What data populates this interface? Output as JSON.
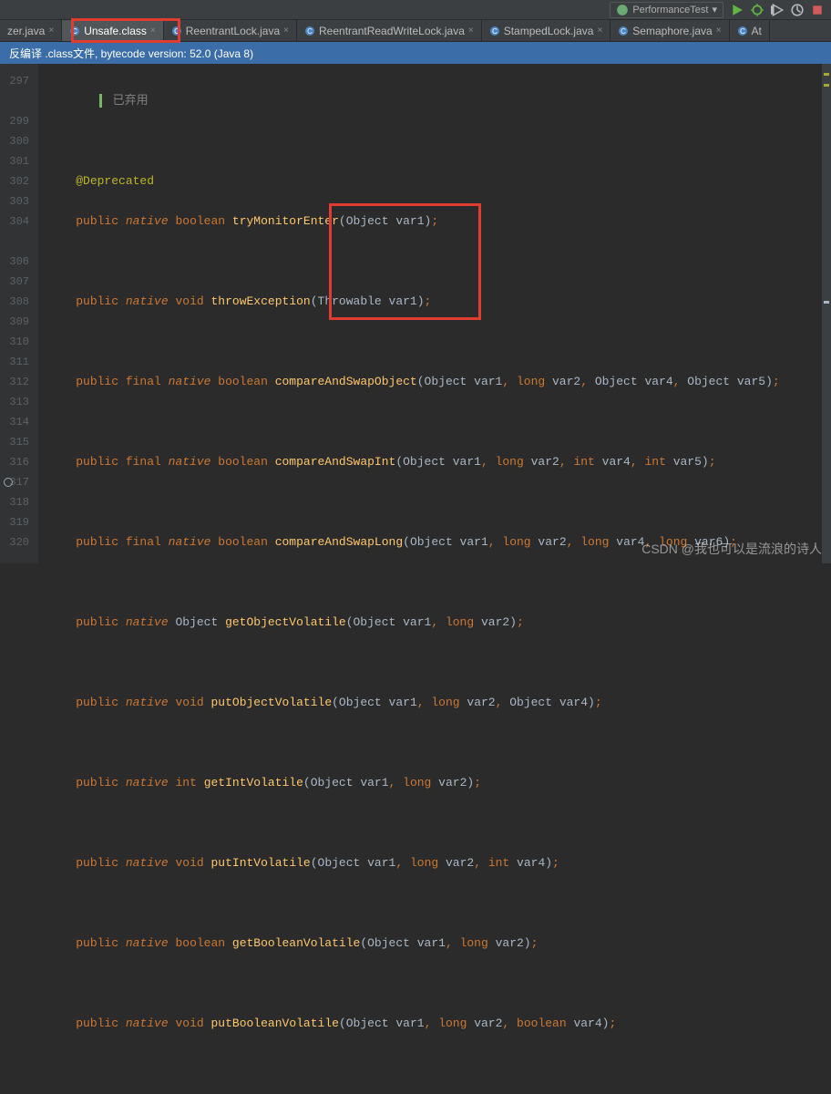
{
  "toolbar": {
    "config_label": "PerformanceTest",
    "run_icon": "run-icon",
    "debug_icon": "debug-icon"
  },
  "tabs": [
    {
      "label": "zer.java"
    },
    {
      "label": "Unsafe.class",
      "active": true
    },
    {
      "label": "ReentrantLock.java"
    },
    {
      "label": "ReentrantReadWriteLock.java"
    },
    {
      "label": "StampedLock.java"
    },
    {
      "label": "Semaphore.java"
    },
    {
      "label": "At"
    }
  ],
  "info_bar": {
    "text": "反编译 .class文件, bytecode version: 52.0 (Java 8)"
  },
  "gutter": {
    "lines": [
      "297",
      "",
      "299",
      "300",
      "301",
      "302",
      "303",
      "304",
      "",
      "306",
      "307",
      "308",
      "309",
      "310",
      "311",
      "312",
      "313",
      "314",
      "315",
      "316",
      "317",
      "318",
      "319",
      "320"
    ],
    "breakpoints": [
      317
    ]
  },
  "code": {
    "deprecated_tag_label": "已弃用",
    "ann_deprecated": "@Deprecated",
    "l300": {
      "mods": "public native boolean",
      "fn": "tryMonitorEnter",
      "sig": "(Object var1);"
    },
    "l302": {
      "mods": "public native void",
      "fn": "throwException",
      "sig": "(Throwable var1);"
    },
    "l304": {
      "mods": "public final native boolean",
      "fn": "compareAndSwapObject",
      "sig": "(Object var1, long var2, Object var4, Object var5);"
    },
    "l306": {
      "mods": "public final native boolean",
      "fn": "compareAndSwapInt",
      "sig": "(Object var1, long var2, int var4, int var5);"
    },
    "l308": {
      "mods": "public final native boolean",
      "fn": "compareAndSwapLong",
      "sig": "(Object var1, long var2, long var4, long var6);"
    },
    "l310": {
      "mods": "public native",
      "rettype": "Object",
      "fn": "getObjectVolatile",
      "sig": "(Object var1, long var2);"
    },
    "l312": {
      "mods": "public native void",
      "fn": "putObjectVolatile",
      "sig": "(Object var1, long var2, Object var4);"
    },
    "l314": {
      "mods": "public native int",
      "fn": "getIntVolatile",
      "sig": "(Object var1, long var2);"
    },
    "l316": {
      "mods": "public native void",
      "fn": "putIntVolatile",
      "sig": "(Object var1, long var2, int var4);"
    },
    "l318": {
      "mods": "public native boolean",
      "fn": "getBooleanVolatile",
      "sig": "(Object var1, long var2);"
    },
    "l320": {
      "mods": "public native void",
      "fn": "putBooleanVolatile",
      "sig": "(Object var1, long var2, boolean var4);"
    }
  },
  "watermark": "CSDN @我也可以是流浪的诗人"
}
